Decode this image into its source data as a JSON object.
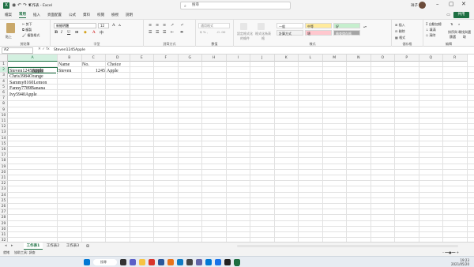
{
  "window": {
    "title": "工作表 - Excel",
    "search_placeholder": "搜尋",
    "user_initial": "祥子",
    "minimize_icon": "minimize-icon",
    "maximize_icon": "maximize-icon",
    "close_icon": "close-icon"
  },
  "ribbon_tabs": [
    "檔案",
    "常用",
    "插入",
    "頁面配置",
    "公式",
    "資料",
    "校閱",
    "檢視",
    "說明"
  ],
  "active_tab": "常用",
  "share_label": "共用",
  "ribbon": {
    "clipboard": {
      "label": "剪貼簿",
      "paste": "貼上",
      "cut": "剪下",
      "copy": "複製",
      "format_painter": "複製格式"
    },
    "font": {
      "label": "字型",
      "font_name": "新細明體",
      "font_size": "12",
      "bold": "B",
      "italic": "I",
      "underline": "U"
    },
    "alignment": {
      "label": "對齊方式"
    },
    "number": {
      "label": "數值",
      "format": "通用格式"
    },
    "styles": {
      "label": "樣式",
      "conditional": "設定格式化的條件",
      "format_as_table": "格式化為表格",
      "cells": [
        "一般",
        "中等",
        "好",
        "計算方式",
        "壞",
        "檢查儲存格"
      ]
    },
    "cells_group": {
      "label": "儲存格",
      "insert": "插入",
      "delete": "刪除",
      "format": "格式"
    },
    "editing": {
      "label": "編輯",
      "autosum": "自動加總",
      "fill": "填滿",
      "clear": "清除",
      "sort": "排序與篩選",
      "find": "尋找與選取"
    }
  },
  "formula_bar": {
    "name_box": "A2",
    "formula": "Steven1245Apple"
  },
  "columns": [
    "A",
    "B",
    "C",
    "D",
    "E",
    "F",
    "G",
    "H",
    "I",
    "J",
    "K",
    "L",
    "M",
    "N",
    "O",
    "P",
    "Q",
    "R"
  ],
  "rows": [
    "1",
    "2",
    "3",
    "4",
    "5",
    "6",
    "7",
    "8",
    "9",
    "10",
    "11",
    "12",
    "13",
    "14",
    "15",
    "16",
    "17",
    "18",
    "19",
    "20",
    "21",
    "22",
    "23",
    "24",
    "25",
    "26",
    "27",
    "28",
    "29",
    "30",
    "31",
    "32"
  ],
  "cells": {
    "B1": "Name",
    "C1": "No.",
    "D1": "Choice",
    "A2_part1": "Steven1245",
    "A2_part2": "Apple",
    "B2": "Steven",
    "C2": "1245",
    "D2": "Apple",
    "A3": "Chris3984Orange",
    "A4": "Sammy8160Lemon",
    "A5": "Fanny7789Banana",
    "A6": "Ivy5940Apple"
  },
  "sheets": [
    "工作表1",
    "工作表2",
    "工作表3"
  ],
  "active_sheet": "工作表1",
  "status": {
    "ready": "就緒",
    "accessibility": "協助工具: 調查"
  },
  "taskbar": {
    "weather": "",
    "search": "搜尋",
    "time": "19:23",
    "date": "2021/05/20"
  },
  "colors": {
    "excel_green": "#1d6f42",
    "selection_fill": "#d3f0e0"
  }
}
